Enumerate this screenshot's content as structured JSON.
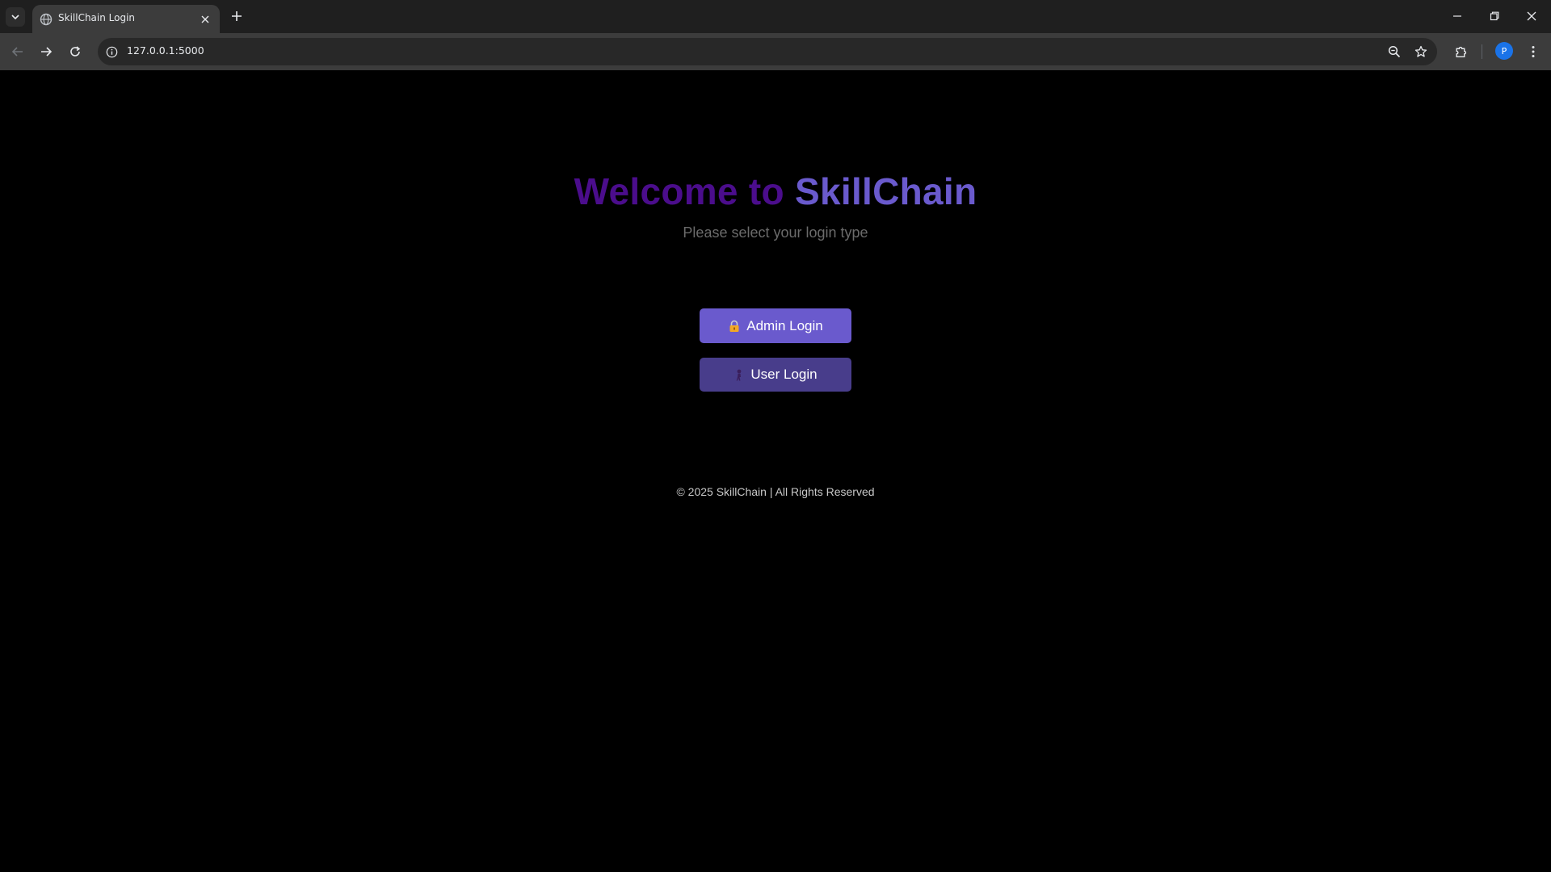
{
  "browser": {
    "tab_title": "SkillChain Login",
    "url": "127.0.0.1:5000",
    "profile_initial": "P"
  },
  "page": {
    "title_part1": "Welcome to",
    "title_part2": "SkillChain",
    "subtitle": "Please select your login type",
    "admin_button": "Admin Login",
    "user_button": "User Login",
    "footer": "© 2025 SkillChain | All Rights Reserved"
  },
  "colors": {
    "title_part1": "#4b0d8c",
    "title_part2": "#6a5acd",
    "admin_button": "#6a5acd",
    "user_button": "#483d8b"
  },
  "icons": {
    "admin_button": "lock-icon",
    "user_button": "person-icon"
  }
}
